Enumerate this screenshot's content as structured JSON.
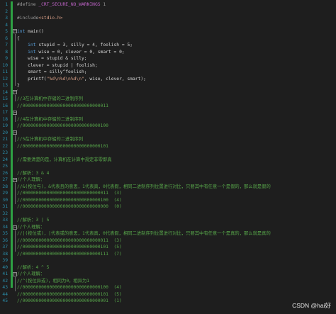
{
  "editor": {
    "lines": [
      {
        "n": "1",
        "text": "#define _CRT_SECURE_NO_WARNINGS 1",
        "kind": "pre"
      },
      {
        "n": "2",
        "text": "",
        "kind": "plain"
      },
      {
        "n": "3",
        "text": "#include<stdio.h>",
        "kind": "pre"
      },
      {
        "n": "4",
        "text": "",
        "kind": "plain"
      },
      {
        "n": "5",
        "text": "int main()",
        "kind": "plain"
      },
      {
        "n": "6",
        "text": "{",
        "kind": "plain"
      },
      {
        "n": "7",
        "text": "    int stupid = 3, silly = 4, foolish = 5;",
        "kind": "plain"
      },
      {
        "n": "8",
        "text": "    int wise = 0, clever = 0, smart = 0;",
        "kind": "plain"
      },
      {
        "n": "9",
        "text": "    wise = stupid & silly;",
        "kind": "plain"
      },
      {
        "n": "10",
        "text": "    clever = stupid | foolish;",
        "kind": "plain"
      },
      {
        "n": "11",
        "text": "    smart = silly^foolish;",
        "kind": "plain"
      },
      {
        "n": "12",
        "text": "    printf(\"%d\\n%d\\n%d\\n\", wise, clever, smart);",
        "kind": "plain"
      },
      {
        "n": "13",
        "text": "}",
        "kind": "plain"
      },
      {
        "n": "14",
        "text": "",
        "kind": "plain"
      },
      {
        "n": "15",
        "text": "//3在计算机中存储的二进制序列",
        "kind": "cmt"
      },
      {
        "n": "16",
        "text": "//00000000000000000000000000000011",
        "kind": "cmt"
      },
      {
        "n": "17",
        "text": "",
        "kind": "plain"
      },
      {
        "n": "18",
        "text": "//4在计算机中存储的二进制序列",
        "kind": "cmt"
      },
      {
        "n": "19",
        "text": "//00000000000000000000000000000100",
        "kind": "cmt"
      },
      {
        "n": "20",
        "text": "",
        "kind": "plain"
      },
      {
        "n": "21",
        "text": "//5在计算机中存储的二进制序列",
        "kind": "cmt"
      },
      {
        "n": "22",
        "text": "//00000000000000000000000000000101",
        "kind": "cmt"
      },
      {
        "n": "23",
        "text": "",
        "kind": "plain"
      },
      {
        "n": "24",
        "text": "//需要清楚的是，计算机在计算中规定非零即真",
        "kind": "cmt"
      },
      {
        "n": "25",
        "text": "",
        "kind": "plain"
      },
      {
        "n": "26",
        "text": "//解析：3 & 4",
        "kind": "cmt"
      },
      {
        "n": "27",
        "text": "//个人理解：",
        "kind": "cmt"
      },
      {
        "n": "28",
        "text": "//&(按位与)，&代表且的意思，1代表真，0代表假，相同二进制序列位置进行对比，只要其中有任意一个是假的，那么就是假的",
        "kind": "cmt"
      },
      {
        "n": "29",
        "text": "//00000000000000000000000000000011  (3)",
        "kind": "cmt"
      },
      {
        "n": "30",
        "text": "//00000000000000000000000000000100  (4)",
        "kind": "cmt"
      },
      {
        "n": "31",
        "text": "//00000000000000000000000000000000  (0)",
        "kind": "cmt"
      },
      {
        "n": "32",
        "text": "",
        "kind": "plain"
      },
      {
        "n": "33",
        "text": "//解析：3 | 5",
        "kind": "cmt"
      },
      {
        "n": "34",
        "text": "//个人理解：",
        "kind": "cmt"
      },
      {
        "n": "35",
        "text": "//|(按位或)，|代表或的意思，1代表真，0代表假，相同二进制序列位置进行对比，只要其中有任意一个是真的，那么就是真的",
        "kind": "cmt"
      },
      {
        "n": "36",
        "text": "//00000000000000000000000000000011  (3)",
        "kind": "cmt"
      },
      {
        "n": "37",
        "text": "//00000000000000000000000000000101  (5)",
        "kind": "cmt"
      },
      {
        "n": "38",
        "text": "//00000000000000000000000000000111  (7)",
        "kind": "cmt"
      },
      {
        "n": "39",
        "text": "",
        "kind": "plain"
      },
      {
        "n": "40",
        "text": "//解析：4 ^ 5",
        "kind": "cmt"
      },
      {
        "n": "41",
        "text": "//个人理解：",
        "kind": "cmt"
      },
      {
        "n": "42",
        "text": "//^(按位异或)，相同为0，相异为1",
        "kind": "cmt"
      },
      {
        "n": "43",
        "text": "//00000000000000000000000000000100  (4)",
        "kind": "cmt"
      },
      {
        "n": "44",
        "text": "//00000000000000000000000000000101  (5)",
        "kind": "cmt"
      },
      {
        "n": "45",
        "text": "//00000000000000000000000000000001  (1)",
        "kind": "cmt"
      }
    ]
  },
  "watermark": "CSDN @hai好",
  "colors": {
    "background": "#1e1e1e",
    "line_number": "#2b91af",
    "comment": "#57a64a",
    "keyword": "#569cd6",
    "string": "#d69d85",
    "macro": "#bd63c5",
    "change_bar": "#2ea043"
  }
}
